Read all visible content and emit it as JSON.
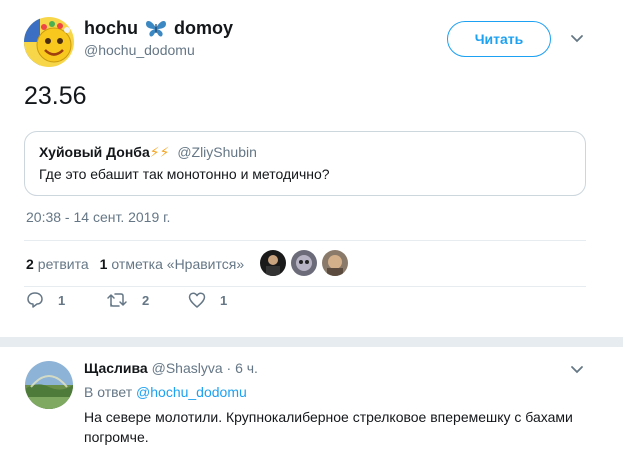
{
  "tweet": {
    "display_name": "hochu",
    "display_name_suffix": "domoy",
    "handle": "@hochu_dodomu",
    "follow_label": "Читать",
    "text": "23.56",
    "timestamp": "20:38 - 14 сент. 2019 г."
  },
  "quote": {
    "name": "Хуйовый Донба",
    "name_emoji": "⚡⚡",
    "handle": "@ZliyShubin",
    "text": "Где это ебашит так монотонно и методично?"
  },
  "stats": {
    "retweets_count": "2",
    "retweets_label": "ретвита",
    "likes_count": "1",
    "likes_label": "отметка «Нравится»"
  },
  "actions": {
    "reply_count": "1",
    "retweet_count": "2",
    "like_count": "1"
  },
  "reply": {
    "name": "Щаслива",
    "handle": "@Shaslyva",
    "time": "· 6 ч.",
    "in_reply_prefix": "В ответ",
    "in_reply_handle": "@hochu_dodomu",
    "text": "На севере молотили. Крупнокалиберное стрелковое вперемешку с бахами погромче."
  },
  "colors": {
    "accent": "#1da1f2",
    "secondary_text": "#657786",
    "border": "#e6ecf0"
  }
}
